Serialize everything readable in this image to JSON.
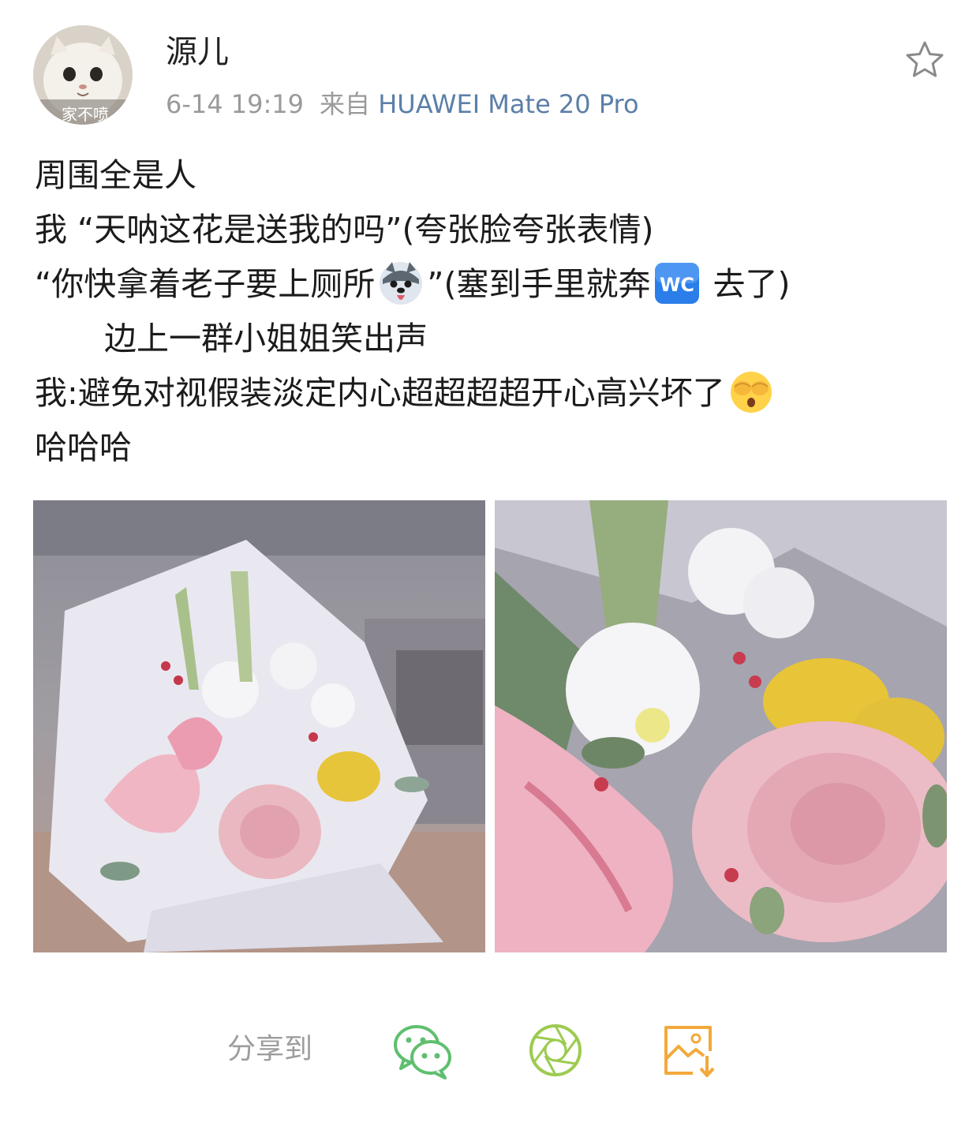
{
  "post": {
    "author": {
      "name": "源儿",
      "avatar_caption": "家不喷"
    },
    "time": "6-14 19:19",
    "source_prefix": "来自",
    "device": "HUAWEI Mate 20 Pro",
    "lines": {
      "l1": "周围全是人",
      "l2": "我 “天呐这花是送我的吗”(夸张脸夸张表情)",
      "l3a": "“你快拿着老子要上厕所",
      "l3b": "”(塞到手里就奔",
      "l3c": " 去了)",
      "l4": "边上一群小姐姐笑出声",
      "l5": "我:避免对视假装淡定内心超超超超开心高兴坏了",
      "l6": "哈哈哈"
    },
    "emoji_wc": "WC",
    "images": [
      "bouquet-photo-1",
      "bouquet-photo-2"
    ]
  },
  "share": {
    "label": "分享到",
    "icons": [
      "wechat-icon",
      "moments-icon",
      "save-image-icon"
    ]
  },
  "colors": {
    "device_link": "#5b7fa8",
    "meta_gray": "#9a9a9a",
    "wechat_green": "#5fbf6f",
    "moments_green": "#9ccb4f",
    "save_orange": "#f2a93b",
    "wc_blue": "#2b7de9"
  }
}
